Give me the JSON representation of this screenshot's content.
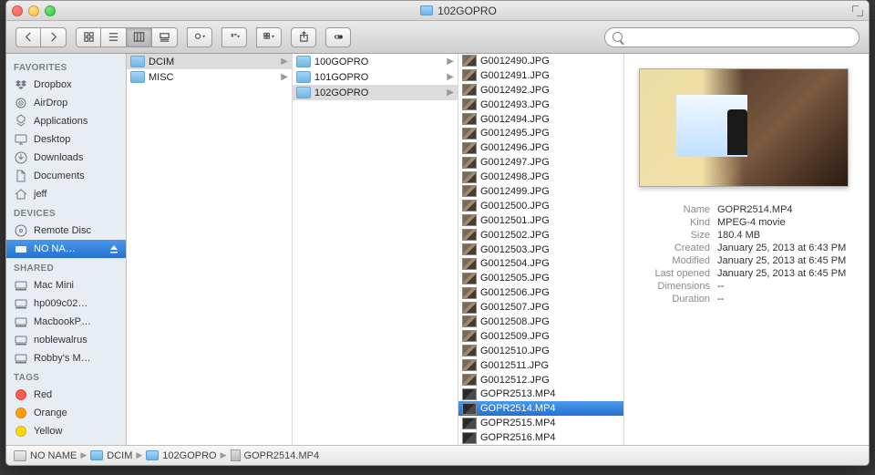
{
  "window_title": "102GOPRO",
  "search": {
    "placeholder": ""
  },
  "sidebar": {
    "sections": [
      {
        "header": "FAVORITES",
        "items": [
          {
            "label": "Dropbox",
            "icon": "box-icon"
          },
          {
            "label": "AirDrop",
            "icon": "airdrop-icon"
          },
          {
            "label": "Applications",
            "icon": "apps-icon"
          },
          {
            "label": "Desktop",
            "icon": "desktop-icon"
          },
          {
            "label": "Downloads",
            "icon": "download-icon"
          },
          {
            "label": "Documents",
            "icon": "document-icon"
          },
          {
            "label": "jeff",
            "icon": "home-icon"
          }
        ]
      },
      {
        "header": "DEVICES",
        "items": [
          {
            "label": "Remote Disc",
            "icon": "disc-icon"
          },
          {
            "label": "NO NA…",
            "icon": "drive-icon",
            "selected": true,
            "eject": true
          }
        ]
      },
      {
        "header": "SHARED",
        "items": [
          {
            "label": "Mac Mini",
            "icon": "computer-icon"
          },
          {
            "label": "hp009c02…",
            "icon": "computer-icon"
          },
          {
            "label": "MacbookP…",
            "icon": "computer-icon"
          },
          {
            "label": "noblewalrus",
            "icon": "computer-icon"
          },
          {
            "label": "Robby's M…",
            "icon": "computer-icon"
          }
        ]
      },
      {
        "header": "TAGS",
        "items": [
          {
            "label": "Red",
            "color": "#ff5a52"
          },
          {
            "label": "Orange",
            "color": "#ff9f0a"
          },
          {
            "label": "Yellow",
            "color": "#ffd60a"
          }
        ]
      }
    ]
  },
  "columns": {
    "c1": [
      {
        "name": "DCIM",
        "type": "folder",
        "selected": true
      },
      {
        "name": "MISC",
        "type": "folder"
      }
    ],
    "c2": [
      {
        "name": "100GOPRO",
        "type": "folder"
      },
      {
        "name": "101GOPRO",
        "type": "folder"
      },
      {
        "name": "102GOPRO",
        "type": "folder",
        "selected": true
      }
    ],
    "c3": [
      {
        "name": "G0012490.JPG",
        "type": "img"
      },
      {
        "name": "G0012491.JPG",
        "type": "img"
      },
      {
        "name": "G0012492.JPG",
        "type": "img"
      },
      {
        "name": "G0012493.JPG",
        "type": "img"
      },
      {
        "name": "G0012494.JPG",
        "type": "img"
      },
      {
        "name": "G0012495.JPG",
        "type": "img"
      },
      {
        "name": "G0012496.JPG",
        "type": "img"
      },
      {
        "name": "G0012497.JPG",
        "type": "img"
      },
      {
        "name": "G0012498.JPG",
        "type": "img"
      },
      {
        "name": "G0012499.JPG",
        "type": "img"
      },
      {
        "name": "G0012500.JPG",
        "type": "img"
      },
      {
        "name": "G0012501.JPG",
        "type": "img"
      },
      {
        "name": "G0012502.JPG",
        "type": "img"
      },
      {
        "name": "G0012503.JPG",
        "type": "img"
      },
      {
        "name": "G0012504.JPG",
        "type": "img"
      },
      {
        "name": "G0012505.JPG",
        "type": "img"
      },
      {
        "name": "G0012506.JPG",
        "type": "img"
      },
      {
        "name": "G0012507.JPG",
        "type": "img"
      },
      {
        "name": "G0012508.JPG",
        "type": "img"
      },
      {
        "name": "G0012509.JPG",
        "type": "img"
      },
      {
        "name": "G0012510.JPG",
        "type": "img"
      },
      {
        "name": "G0012511.JPG",
        "type": "img"
      },
      {
        "name": "G0012512.JPG",
        "type": "img"
      },
      {
        "name": "GOPR2513.MP4",
        "type": "mov"
      },
      {
        "name": "GOPR2514.MP4",
        "type": "mov",
        "selected": true
      },
      {
        "name": "GOPR2515.MP4",
        "type": "mov"
      },
      {
        "name": "GOPR2516.MP4",
        "type": "mov"
      }
    ]
  },
  "preview": {
    "meta": [
      {
        "k": "Name",
        "v": "GOPR2514.MP4"
      },
      {
        "k": "Kind",
        "v": "MPEG-4 movie"
      },
      {
        "k": "Size",
        "v": "180.4 MB"
      },
      {
        "k": "Created",
        "v": "January 25, 2013 at 6:43 PM"
      },
      {
        "k": "Modified",
        "v": "January 25, 2013 at 6:45 PM"
      },
      {
        "k": "Last opened",
        "v": "January 25, 2013 at 6:45 PM"
      },
      {
        "k": "Dimensions",
        "v": "--"
      },
      {
        "k": "Duration",
        "v": "--"
      }
    ]
  },
  "pathbar": [
    {
      "label": "NO NAME",
      "icon": "drive"
    },
    {
      "label": "DCIM",
      "icon": "folder"
    },
    {
      "label": "102GOPRO",
      "icon": "folder"
    },
    {
      "label": "GOPR2514.MP4",
      "icon": "mov"
    }
  ]
}
